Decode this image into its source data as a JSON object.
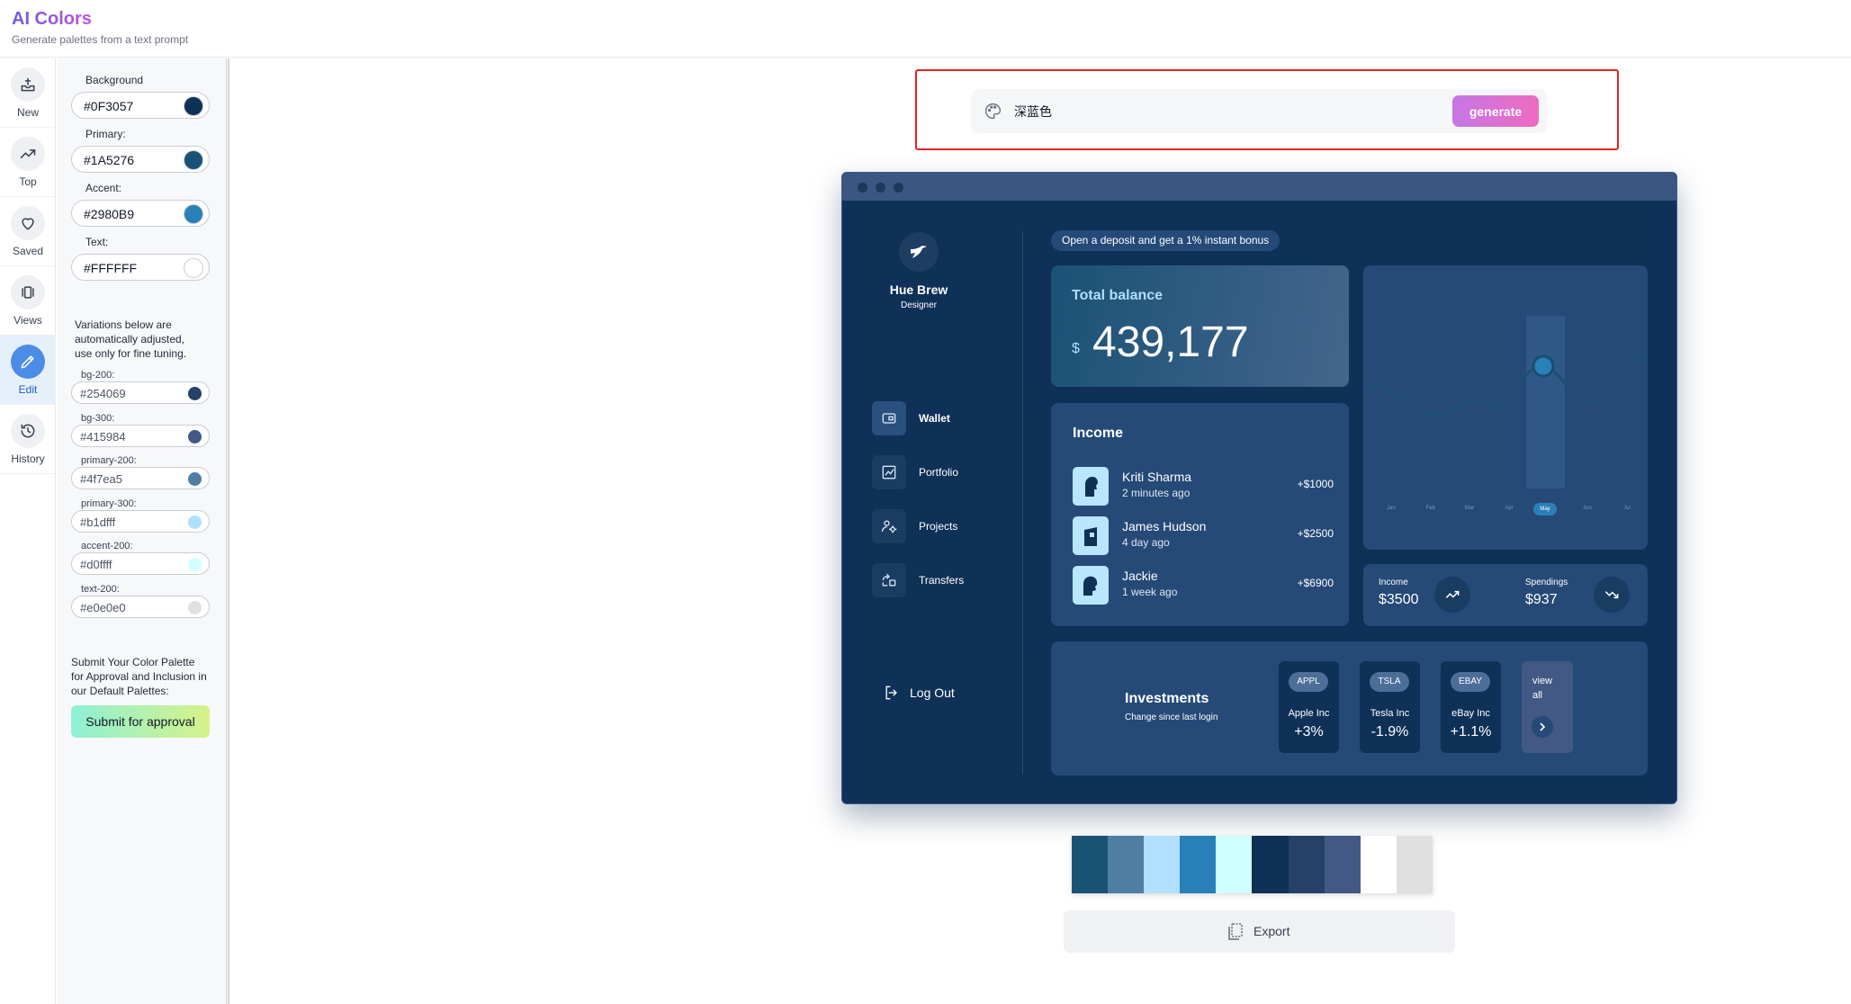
{
  "header": {
    "title": "AI Colors",
    "subtitle": "Generate palettes from a text prompt"
  },
  "nav": {
    "items": [
      {
        "label": "New",
        "icon": "tray-icon"
      },
      {
        "label": "Top",
        "icon": "trending-up-icon"
      },
      {
        "label": "Saved",
        "icon": "heart-icon"
      },
      {
        "label": "Views",
        "icon": "carousel-icon"
      },
      {
        "label": "Edit",
        "icon": "pencil-icon",
        "active": true
      },
      {
        "label": "History",
        "icon": "history-icon"
      }
    ]
  },
  "editor": {
    "fields": [
      {
        "label": "Background",
        "value": "#0F3057",
        "color": "#0F3057"
      },
      {
        "label": "Primary:",
        "value": "#1A5276",
        "color": "#1A5276"
      },
      {
        "label": "Accent:",
        "value": "#2980B9",
        "color": "#2980B9"
      },
      {
        "label": "Text:",
        "value": "#FFFFFF",
        "color": "#FFFFFF"
      }
    ],
    "variation_note": "Variations below are automatically adjusted, use only for fine tuning.",
    "variations": [
      {
        "label": "bg-200:",
        "value": "#254069",
        "color": "#254069"
      },
      {
        "label": "bg-300:",
        "value": "#415984",
        "color": "#415984"
      },
      {
        "label": "primary-200:",
        "value": "#4f7ea5",
        "color": "#4f7ea5"
      },
      {
        "label": "primary-300:",
        "value": "#b1dfff",
        "color": "#b1dfff"
      },
      {
        "label": "accent-200:",
        "value": "#d0ffff",
        "color": "#d0ffff"
      },
      {
        "label": "text-200:",
        "value": "#e0e0e0",
        "color": "#e0e0e0"
      }
    ],
    "submit_note": "Submit Your Color Palette for Approval and Inclusion in our Default Palettes:",
    "submit_label": "Submit for approval"
  },
  "prompt": {
    "value": "深蓝色",
    "generate_label": "generate"
  },
  "preview": {
    "profile": {
      "name": "Hue Brew",
      "role": "Designer"
    },
    "nav": [
      "Wallet",
      "Portfolio",
      "Projects",
      "Transfers"
    ],
    "logout": "Log Out",
    "promo": "Open a deposit and get a 1% instant bonus",
    "balance": {
      "title": "Total balance",
      "currency": "$",
      "amount": "439,177"
    },
    "chart": {
      "months": [
        "Jan",
        "Feb",
        "Mar",
        "Apr",
        "May",
        "Jun",
        "Jul"
      ],
      "selected": "May"
    },
    "income": {
      "title": "Income",
      "rows": [
        {
          "name": "Kriti Sharma",
          "time": "2 minutes ago",
          "amount": "+$1000"
        },
        {
          "name": "James Hudson",
          "time": "4 day ago",
          "amount": "+$2500"
        },
        {
          "name": "Jackie",
          "time": "1 week ago",
          "amount": "+$6900"
        }
      ]
    },
    "stats": {
      "income_label": "Income",
      "income_value": "$3500",
      "spend_label": "Spendings",
      "spend_value": "$937"
    },
    "investments": {
      "title": "Investments",
      "subtitle": "Change since last login",
      "stocks": [
        {
          "ticker": "APPL",
          "name": "Apple Inc",
          "change": "+3%"
        },
        {
          "ticker": "TSLA",
          "name": "Tesla Inc",
          "change": "-1.9%"
        },
        {
          "ticker": "EBAY",
          "name": "eBay Inc",
          "change": "+1.1%"
        }
      ],
      "view_all": "view all"
    }
  },
  "palette": [
    "#1A5276",
    "#4f7ea5",
    "#b1dfff",
    "#2980B9",
    "#d0ffff",
    "#0F3057",
    "#254069",
    "#415984",
    "#FFFFFF",
    "#e0e0e0"
  ],
  "export_label": "Export"
}
